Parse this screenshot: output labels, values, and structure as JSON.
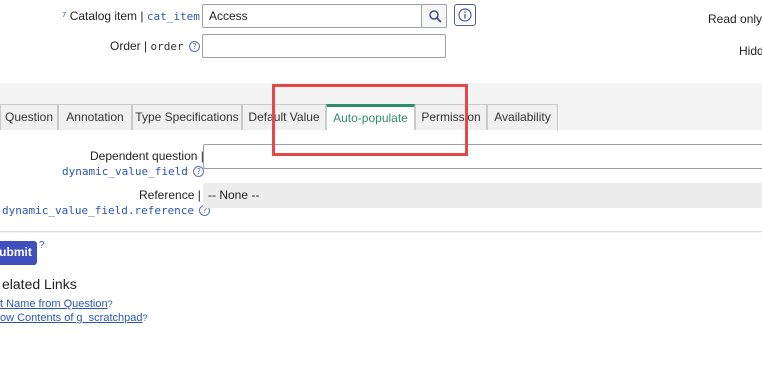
{
  "header": {
    "catalog_item": {
      "prefix": "⁷",
      "label": "Catalog item",
      "separator": "|",
      "field": "cat_item",
      "value": "Access"
    },
    "order": {
      "label": "Order",
      "separator": "|",
      "field": "order",
      "value": ""
    },
    "right": {
      "read_only": "Read only",
      "read_only_sep": "|",
      "hidden": "Hidd"
    }
  },
  "tabs": [
    {
      "label": "Question",
      "active": false
    },
    {
      "label": "Annotation",
      "active": false
    },
    {
      "label": "Type Specifications",
      "active": false
    },
    {
      "label": "Default Value",
      "active": false
    },
    {
      "label": "Auto-populate",
      "active": true
    },
    {
      "label": "Permission",
      "active": false
    },
    {
      "label": "Availability",
      "active": false
    }
  ],
  "form": {
    "dependent_question": {
      "label": "Dependent question",
      "separator": "|",
      "field": "dynamic_value_field",
      "value": ""
    },
    "reference": {
      "label": "Reference",
      "separator": "|",
      "field": "dynamic_value_field.reference",
      "value": "-- None --"
    }
  },
  "actions": {
    "submit_label": "ubmit",
    "submit_help": "?"
  },
  "related": {
    "title": "elated Links",
    "links": [
      {
        "label": "t Name from Question",
        "mark": "?"
      },
      {
        "label": "ow Contents of g_scratchpad",
        "mark": "?"
      }
    ]
  },
  "colors": {
    "accent": "#2f8c6b",
    "link": "#2a56b3",
    "submit_bg": "#3f4fbf",
    "highlight": "#e54848"
  }
}
